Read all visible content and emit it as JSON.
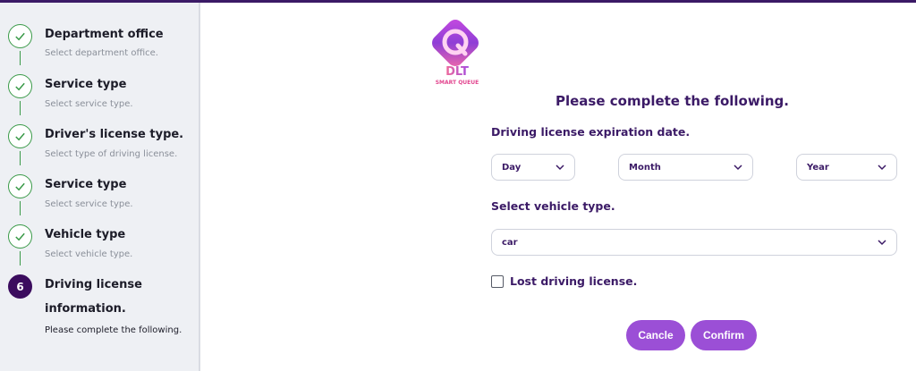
{
  "steps": [
    {
      "title": "Department office",
      "subtitle": "Select department office."
    },
    {
      "title": "Service type",
      "subtitle": "Select service type."
    },
    {
      "title": "Driver's license type.",
      "subtitle": "Select type of driving license."
    },
    {
      "title": "Service type",
      "subtitle": "Select service type."
    },
    {
      "title": "Vehicle type",
      "subtitle": "Select vehicle type."
    },
    {
      "number": "6",
      "title_line1": "Driving license",
      "title_line2": "information.",
      "subtitle": "Please complete the following."
    }
  ],
  "logo": {
    "letter": "Q",
    "brand": "DLT",
    "tagline": "SMART QUEUE"
  },
  "form": {
    "heading": "Please complete the following.",
    "expiration_label": "Driving license expiration date.",
    "day": "Day",
    "month": "Month",
    "year": "Year",
    "vehicle_label": "Select vehicle type.",
    "vehicle_value": "car",
    "lost_label": "Lost driving license."
  },
  "buttons": {
    "cancel": "Cancle",
    "confirm": "Confirm"
  },
  "colors": {
    "primary": "#3b1a66",
    "accent": "#9b4fd6",
    "check": "#3a9a48",
    "active_step": "#3b0c5e"
  }
}
